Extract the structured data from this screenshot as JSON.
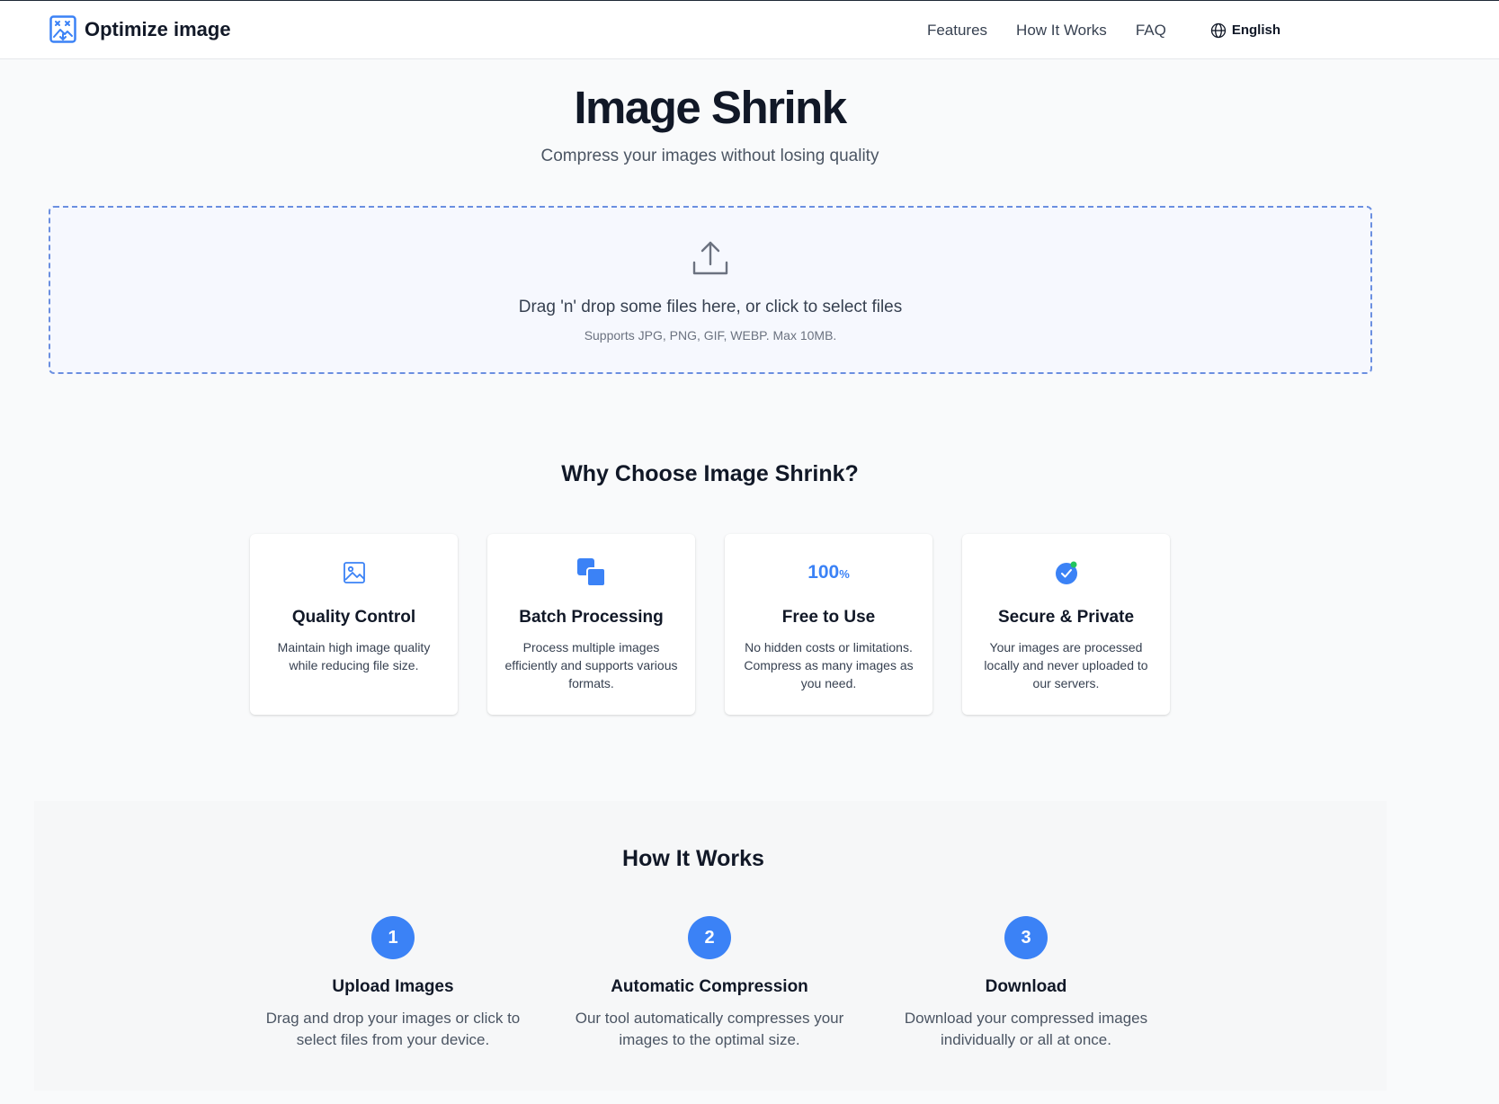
{
  "header": {
    "brand": "Optimize image",
    "nav": [
      "Features",
      "How It Works",
      "FAQ"
    ],
    "language": "English"
  },
  "hero": {
    "title": "Image Shrink",
    "subtitle": "Compress your images without losing quality"
  },
  "dropzone": {
    "text": "Drag 'n' drop some files here, or click to select files",
    "hint": "Supports JPG, PNG, GIF, WEBP. Max 10MB."
  },
  "why": {
    "title": "Why Choose Image Shrink?",
    "cards": [
      {
        "icon": "image-icon",
        "title": "Quality Control",
        "desc": "Maintain high image quality while reducing file size."
      },
      {
        "icon": "layers-icon",
        "title": "Batch Processing",
        "desc": "Process multiple images efficiently and supports various formats."
      },
      {
        "icon": "percent-badge",
        "badge": "100",
        "badge_unit": "%",
        "title": "Free to Use",
        "desc": "No hidden costs or limitations. Compress as many images as you need."
      },
      {
        "icon": "shield-check-icon",
        "title": "Secure & Private",
        "desc": "Your images are processed locally and never uploaded to our servers."
      }
    ]
  },
  "how": {
    "title": "How It Works",
    "steps": [
      {
        "num": "1",
        "title": "Upload Images",
        "desc": "Drag and drop your images or click to select files from your device."
      },
      {
        "num": "2",
        "title": "Automatic Compression",
        "desc": "Our tool automatically compresses your images to the optimal size."
      },
      {
        "num": "3",
        "title": "Download",
        "desc": "Download your compressed images individually or all at once."
      }
    ]
  },
  "colors": {
    "accent": "#3b82f6",
    "dash_border": "#6b8fe0",
    "text": "#111827"
  }
}
